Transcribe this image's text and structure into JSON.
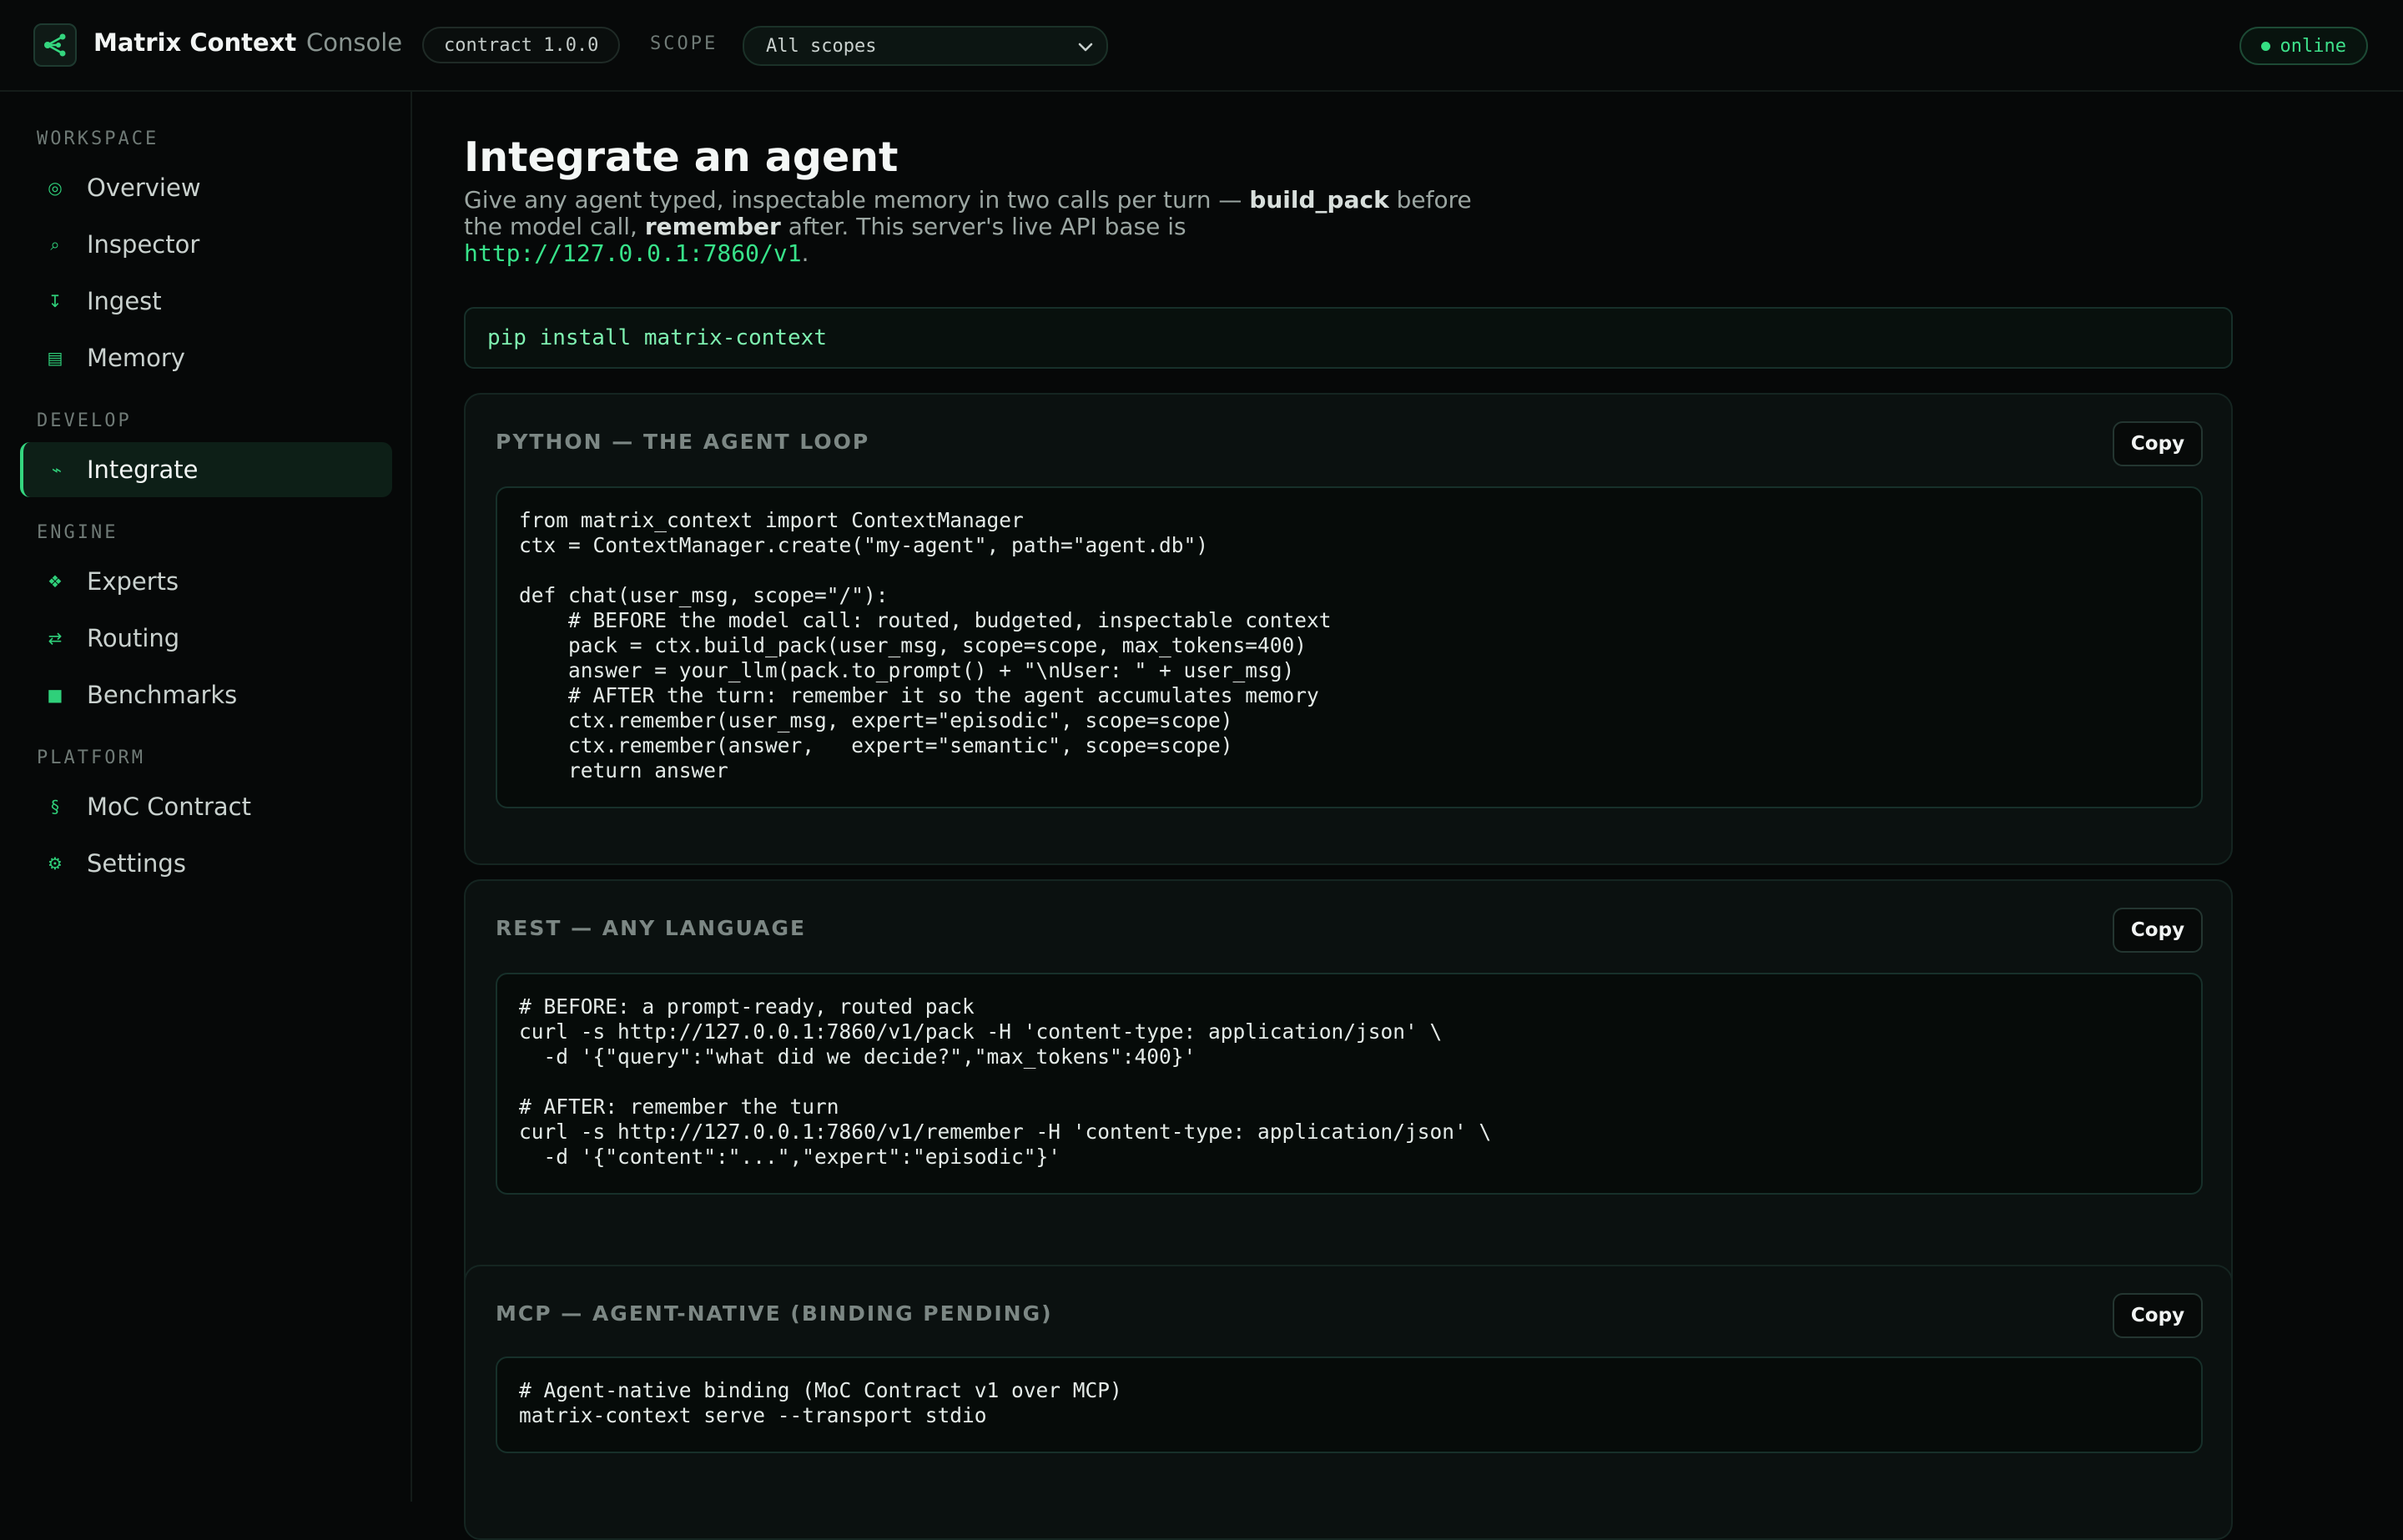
{
  "header": {
    "brand": "Matrix Context",
    "brand_sub": "Console",
    "version": "contract 1.0.0",
    "scope_label": "SCOPE",
    "scope_value": "All scopes",
    "status": "online"
  },
  "sidebar": {
    "sections": [
      {
        "title": "WORKSPACE",
        "items": [
          {
            "label": "Overview",
            "icon": "◎",
            "icon_name": "target-icon"
          },
          {
            "label": "Inspector",
            "icon": "⌕",
            "icon_name": "search-icon"
          },
          {
            "label": "Ingest",
            "icon": "↧",
            "icon_name": "download-icon"
          },
          {
            "label": "Memory",
            "icon": "▤",
            "icon_name": "database-icon"
          }
        ]
      },
      {
        "title": "DEVELOP",
        "items": [
          {
            "label": "Integrate",
            "icon": "⌁",
            "icon_name": "plug-icon",
            "active": true
          }
        ]
      },
      {
        "title": "ENGINE",
        "items": [
          {
            "label": "Experts",
            "icon": "❖",
            "icon_name": "diamond-icon"
          },
          {
            "label": "Routing",
            "icon": "⇄",
            "icon_name": "swap-arrows-icon"
          },
          {
            "label": "Benchmarks",
            "icon": "■",
            "icon_name": "square-icon"
          }
        ]
      },
      {
        "title": "PLATFORM",
        "items": [
          {
            "label": "MoC Contract",
            "icon": "§",
            "icon_name": "section-icon"
          },
          {
            "label": "Settings",
            "icon": "⚙",
            "icon_name": "gear-icon"
          }
        ]
      }
    ]
  },
  "main": {
    "title": "Integrate an agent",
    "desc_part1": "Give any agent typed, inspectable memory in two calls per turn — ",
    "desc_bold1": "build_pack",
    "desc_part2": " before the model call, ",
    "desc_bold2": "remember",
    "desc_part3": " after. This server's live API base is ",
    "desc_link": "http://127.0.0.1:7860/v1",
    "desc_end": ".",
    "install_cmd": "pip install matrix-context",
    "copy_label": "Copy",
    "cards": [
      {
        "title": "PYTHON — THE AGENT LOOP",
        "code": "from matrix_context import ContextManager\nctx = ContextManager.create(\"my-agent\", path=\"agent.db\")\n\ndef chat(user_msg, scope=\"/\"):\n    # BEFORE the model call: routed, budgeted, inspectable context\n    pack = ctx.build_pack(user_msg, scope=scope, max_tokens=400)\n    answer = your_llm(pack.to_prompt() + \"\\nUser: \" + user_msg)\n    # AFTER the turn: remember it so the agent accumulates memory\n    ctx.remember(user_msg, expert=\"episodic\", scope=scope)\n    ctx.remember(answer,   expert=\"semantic\", scope=scope)\n    return answer"
      },
      {
        "title": "REST — ANY LANGUAGE",
        "code": "# BEFORE: a prompt-ready, routed pack\ncurl -s http://127.0.0.1:7860/v1/pack -H 'content-type: application/json' \\\n  -d '{\"query\":\"what did we decide?\",\"max_tokens\":400}'\n\n# AFTER: remember the turn\ncurl -s http://127.0.0.1:7860/v1/remember -H 'content-type: application/json' \\\n  -d '{\"content\":\"...\",\"expert\":\"episodic\"}'"
      },
      {
        "title": "MCP — AGENT-NATIVE (BINDING PENDING)",
        "code": "# Agent-native binding (MoC Contract v1 over MCP)\nmatrix-context serve --transport stdio"
      }
    ]
  },
  "colors": {
    "accent": "#34d67f",
    "background": "#060808",
    "card": "#0b1110"
  }
}
